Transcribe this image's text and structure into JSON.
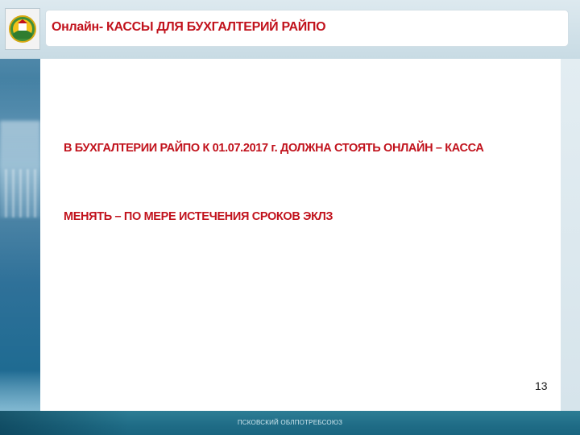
{
  "header": {
    "title": "Онлайн- КАССЫ ДЛЯ БУХГАЛТЕРИЙ РАЙПО",
    "logo_icon": "cooperative-emblem-icon"
  },
  "main": {
    "paragraphs": [
      "В БУХГАЛТЕРИИ РАЙПО К 01.07.2017 г. ДОЛЖНА СТОЯТЬ ОНЛАЙН – КАССА",
      "МЕНЯТЬ – ПО МЕРЕ ИСТЕЧЕНИЯ СРОКОВ ЭКЛЗ"
    ],
    "page_number": "13"
  },
  "footer": {
    "text": "ПСКОВСКИЙ ОБЛПОТРЕБСОЮЗ"
  },
  "colors": {
    "accent_red": "#c1121c",
    "footer_teal": "#1f6c86",
    "header_band": "#dde9ef"
  }
}
